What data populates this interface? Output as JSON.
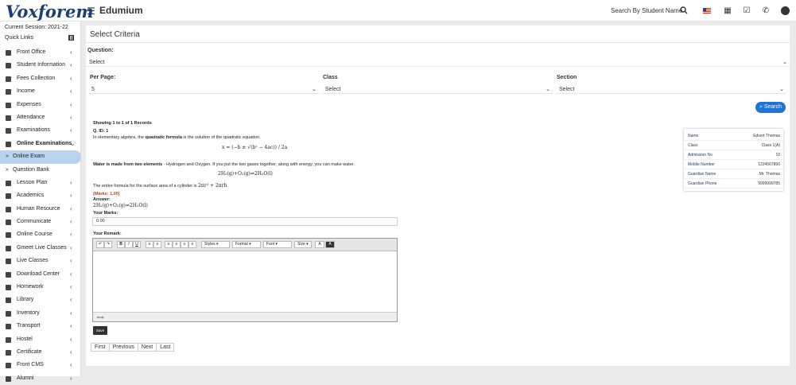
{
  "header": {
    "logo": "Voxforem",
    "app_title": "Edumium",
    "search_label": "Search By Student Name"
  },
  "sidebar": {
    "session": "Current Session: 2021-22",
    "quick_links": "Quick Links",
    "items": [
      {
        "label": "Front Office",
        "icon": "desk-icon"
      },
      {
        "label": "Student Information",
        "icon": "users-icon"
      },
      {
        "label": "Fees Collection",
        "icon": "money-icon"
      },
      {
        "label": "Income",
        "icon": "dollar-icon"
      },
      {
        "label": "Expenses",
        "icon": "card-icon"
      },
      {
        "label": "Attendance",
        "icon": "calendar-icon"
      },
      {
        "label": "Examinations",
        "icon": "map-icon"
      },
      {
        "label": "Online Examinations",
        "icon": "rss-icon"
      },
      {
        "label": "Online Exam",
        "icon": "arrow-icon"
      },
      {
        "label": "Question Bank",
        "icon": "arrow-icon"
      },
      {
        "label": "Lesson Plan",
        "icon": "list-icon"
      },
      {
        "label": "Academics",
        "icon": "cap-icon"
      },
      {
        "label": "Human Resource",
        "icon": "sitemap-icon"
      },
      {
        "label": "Communicate",
        "icon": "bullhorn-icon"
      },
      {
        "label": "Online Course",
        "icon": "book-icon"
      },
      {
        "label": "Gmeet Live Classes",
        "icon": "video-icon"
      },
      {
        "label": "Live Classes",
        "icon": "camera-icon"
      },
      {
        "label": "Download Center",
        "icon": "download-icon"
      },
      {
        "label": "Homework",
        "icon": "flask-icon"
      },
      {
        "label": "Library",
        "icon": "book-icon"
      },
      {
        "label": "Inventory",
        "icon": "inventory-icon"
      },
      {
        "label": "Transport",
        "icon": "bus-icon"
      },
      {
        "label": "Hostel",
        "icon": "building-icon"
      },
      {
        "label": "Certificate",
        "icon": "certificate-icon"
      },
      {
        "label": "Front CMS",
        "icon": "cms-icon"
      },
      {
        "label": "Alumni",
        "icon": "alumni-icon"
      }
    ]
  },
  "criteria": {
    "title": "Select Criteria",
    "question_label": "Question:",
    "question_value": "Select",
    "per_page_label": "Per Page:",
    "per_page_value": "5",
    "class_label": "Class",
    "class_value": "Select",
    "section_label": "Section",
    "section_value": "Select",
    "search_button": "Search"
  },
  "result": {
    "showing": "Showing 1 to 1 of 1 Records",
    "qid": "Q. ID: 1",
    "line1_a": "In elementary algebra, the ",
    "line1_b": "quadratic formula",
    "line1_c": " is the solution of the quadratic equation.",
    "formula1": "x = (−b ± √(b² − 4ac)) / 2a",
    "line2_a": "Water is made from two elements",
    "line2_b": " - Hydrogen and Oxygen. If you put the two gases together, along with energy, you can make water.",
    "formula2": "2H₂(g)+O₂(g)⇌2H₂O(l)",
    "line3": "The entire formula for the surface area of a cylinder is",
    "formula3": "2πr² + 2πrh",
    "marks": "(Marks: 1.00)",
    "answer_label": "Answer:",
    "answer": "2H₂(g)+O₂(g)⇌2H₂O(l)",
    "your_marks_label": "Your Marks:",
    "your_marks_value": "0.00",
    "your_remark_label": "Your Remark:",
    "editor_footer": "body",
    "save_button": "Save"
  },
  "editor_toolbar": {
    "styles": "Styles",
    "format": "Format",
    "font": "Font",
    "size": "Size"
  },
  "pagination": [
    "First",
    "Previous",
    "Next",
    "Last"
  ],
  "student": [
    {
      "key": "Name",
      "value": "Edvert Thomas"
    },
    {
      "key": "Class",
      "value": "Class 1(A)"
    },
    {
      "key": "Admission No",
      "value": "10"
    },
    {
      "key": "Mobile Number",
      "value": "1234567890"
    },
    {
      "key": "Guardian Name",
      "value": "Mr. Thomas"
    },
    {
      "key": "Guardian Phone",
      "value": "9999999785"
    }
  ],
  "colors": {
    "accent": "#1e74d6",
    "active_item": "#b8d3f0",
    "logo": "#1c3f7a"
  }
}
